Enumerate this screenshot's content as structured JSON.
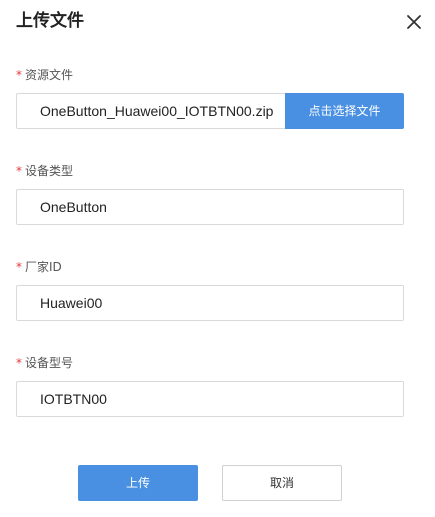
{
  "dialog": {
    "title": "上传文件",
    "close_icon": "close-icon"
  },
  "fields": {
    "resource_file": {
      "required_mark": "*",
      "label": "资源文件",
      "value": "OneButton_Huawei00_IOTBTN00.zip",
      "select_button": "点击选择文件"
    },
    "device_type": {
      "required_mark": "*",
      "label": "设备类型",
      "value": "OneButton"
    },
    "manufacturer_id": {
      "required_mark": "*",
      "label": "厂家ID",
      "value": "Huawei00"
    },
    "device_model": {
      "required_mark": "*",
      "label": "设备型号",
      "value": "IOTBTN00"
    }
  },
  "actions": {
    "upload_label": "上传",
    "cancel_label": "取消"
  },
  "colors": {
    "accent": "#4a90e2",
    "required": "#e4393c",
    "border": "#d9d9d9"
  }
}
